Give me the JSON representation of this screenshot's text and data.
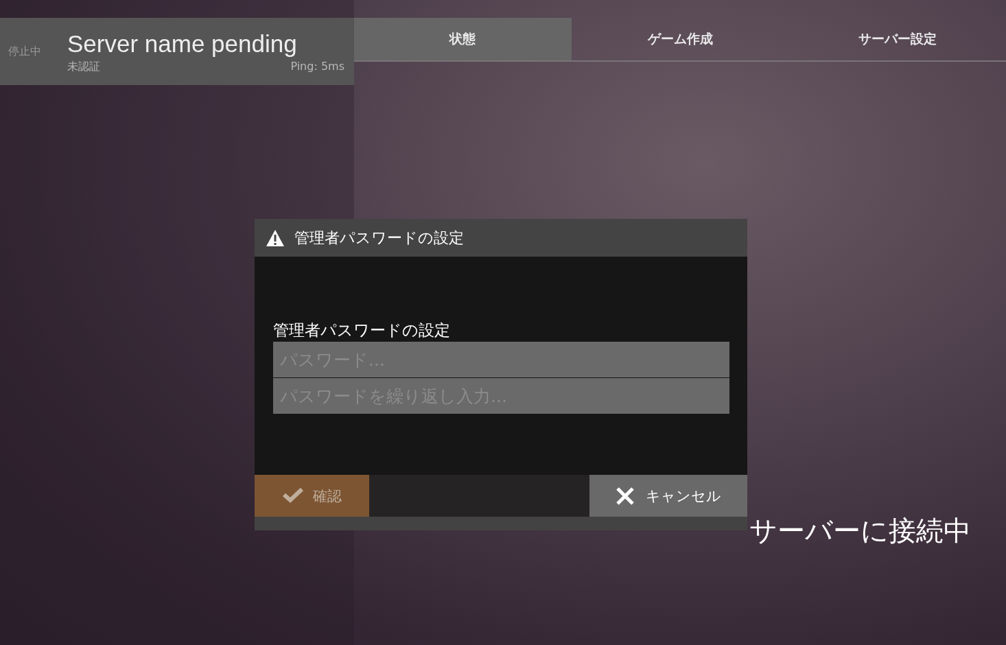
{
  "server": {
    "status": "停止中",
    "name": "Server name pending",
    "auth": "未認証",
    "ping": "Ping: 5ms"
  },
  "tabs": [
    {
      "label": "状態",
      "selected": true
    },
    {
      "label": "ゲーム作成",
      "selected": false
    },
    {
      "label": "サーバー設定",
      "selected": false
    }
  ],
  "dialog": {
    "title": "管理者パスワードの設定",
    "label": "管理者パスワードの設定",
    "fields": [
      {
        "placeholder": "パスワード..."
      },
      {
        "placeholder": "パスワードを繰り返し入力..."
      }
    ],
    "buttons": [
      {
        "kind": "confirm",
        "label": "確認",
        "disabled": true
      },
      {
        "kind": "cancel",
        "label": "キャンセル",
        "disabled": false
      }
    ]
  },
  "connection_status": "サーバーに接続中"
}
